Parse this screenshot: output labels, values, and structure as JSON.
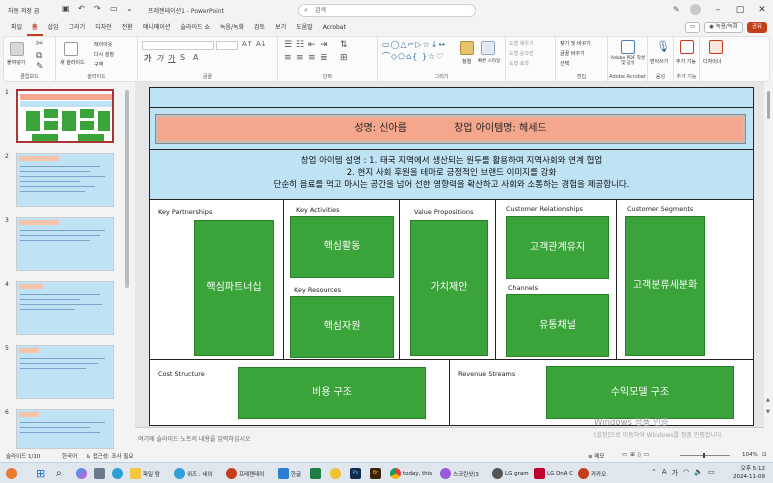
{
  "titlebar": {
    "autosave_label": "자동 저장",
    "autosave_state": "끔",
    "doc_title": "프레젠테이션1 - PowerPoint",
    "search_placeholder": "검색"
  },
  "menu": {
    "tabs": [
      "파일",
      "홈",
      "삽입",
      "그리기",
      "디자인",
      "전환",
      "애니메이션",
      "슬라이드 쇼",
      "녹음/녹화",
      "검토",
      "보기",
      "도움말",
      "Acrobat"
    ],
    "active_tab": "홈",
    "record_btn": "◉ 녹음/녹화",
    "share_btn": "공유"
  },
  "ribbon": {
    "clipboard": {
      "label": "클립보드",
      "paste": "붙여넣기"
    },
    "slides": {
      "label": "슬라이드",
      "new_slide": "새 슬라이드",
      "layout": "레이아웃",
      "reset": "다시 설정",
      "section": "구역"
    },
    "font": {
      "label": "글꼴"
    },
    "paragraph": {
      "label": "단락"
    },
    "drawing": {
      "label": "그리기",
      "arrange": "정렬",
      "quick_styles": "빠른 스타일",
      "fill": "도형 채우기",
      "outline": "도형 윤곽선",
      "effects": "도형 효과"
    },
    "editing": {
      "label": "편집",
      "find": "찾기 및 바꾸기",
      "replace": "글꼴 바꾸기",
      "select": "선택"
    },
    "acrobat": {
      "label": "Adobe Acrobat",
      "create": "Adobe PDF 작성 및 공유"
    },
    "voice": {
      "label": "음성",
      "dictate": "받아쓰기"
    },
    "addins": {
      "label": "추가 기능",
      "addins": "추가 기능"
    },
    "designer": {
      "label": "디자이너"
    }
  },
  "thumbnails": [
    "1",
    "2",
    "3",
    "4",
    "5",
    "6"
  ],
  "slide": {
    "name_label": "성명: 신아름",
    "item_label": "창업 아이템명: 헤세드",
    "description": [
      "창업 아이템 설명 : 1. 태국 지역에서 생산되는 원두를 활용하여 지역사회와 연계 협업",
      "2. 현지 사회 후원을 테마로 긍정적인 브랜드 이미지를 강화",
      "단순히 음료를 먹고 마시는 공간을 넘어 선한 영향력을 확산하고 사회와 소통하는 경험을 제공합니다."
    ],
    "cells": {
      "key_partnerships": {
        "label": "Key Partnerships",
        "box": "핵심파트너십"
      },
      "key_activities": {
        "label": "Key Activities",
        "box": "핵심활동"
      },
      "key_resources": {
        "label": "Key Resources",
        "box": "핵심자원"
      },
      "value_propositions": {
        "label": "Value Propositions",
        "box": "가치제안"
      },
      "customer_relationships": {
        "label": "Customer Relationships",
        "box": "고객관계유지"
      },
      "channels": {
        "label": "Channels",
        "box": "유통채널"
      },
      "customer_segments": {
        "label": "Customer Segments",
        "box": "고객분류세분화"
      },
      "cost_structure": {
        "label": "Cost Structure",
        "box": "비용 구조"
      },
      "revenue_streams": {
        "label": "Revenue Streams",
        "box": "수익모델 구조"
      }
    }
  },
  "notes_placeholder": "여기에 슬라이드 노트의 내용을 입력하십시오",
  "watermark": {
    "line1": "Windows 정품 인증",
    "line2": "[설정]으로 이동하여 Windows를 정품 인증합니다."
  },
  "status": {
    "slide_count": "슬라이드 1/10",
    "language": "한국어",
    "accessibility": "접근성: 조사 필요",
    "notes": "메모",
    "zoom": "104%"
  },
  "taskbar": {
    "items": [
      "파일 탐",
      "위즈 : 네이",
      "프레젠테이",
      "한글",
      "today, this",
      "스크린샷(3",
      "LG gram",
      "LG DnA C",
      "카카오"
    ],
    "time": "오후 5:12",
    "date": "2024-11-09",
    "ime_label": "가"
  },
  "colors": {
    "accent": "#c43e1c",
    "slide_blue": "#bfe3f5",
    "title_salmon": "#f4a78d",
    "box_green": "#3aa33a"
  }
}
